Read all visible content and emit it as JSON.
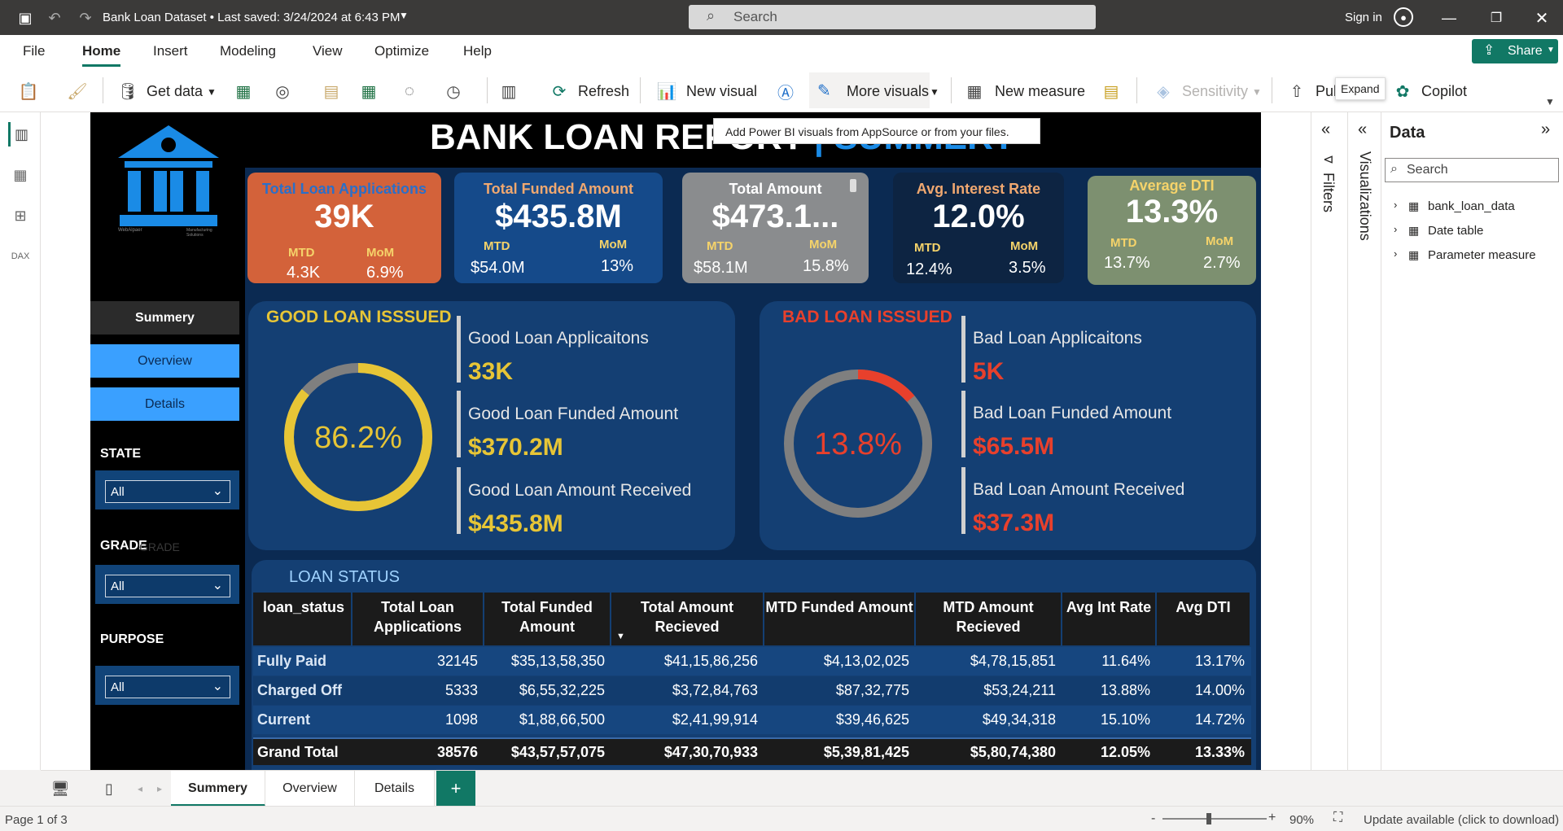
{
  "titlebar": {
    "title": "Bank Loan Dataset • Last saved: 3/24/2024 at 6:43 PM",
    "search": "Search",
    "signin": "Sign in"
  },
  "menu": [
    "File",
    "Home",
    "Insert",
    "Modeling",
    "View",
    "Optimize",
    "Help"
  ],
  "share": "Share",
  "ribbon": {
    "get_data": "Get data",
    "refresh": "Refresh",
    "new_visual": "New visual",
    "more_visuals": "More visuals",
    "new_measure": "New measure",
    "sensitivity": "Sensitivity",
    "publish": "Pul",
    "copilot": "Copilot"
  },
  "tooltip": "Add Power BI visuals from AppSource or from your files.",
  "expand_tip": "Expand",
  "report": {
    "title_a": "BANK LOAN REPORT",
    "title_b": "| SUMMERY",
    "logo_small_left": "WebAlpaer",
    "logo_small_right": "Manufacturing Solutions",
    "nav": [
      "Summery",
      "Overview",
      "Details"
    ],
    "filters": [
      {
        "label": "STATE",
        "value": "All"
      },
      {
        "label": "GRADE",
        "ghost": "GRADE",
        "value": "All"
      },
      {
        "label": "PURPOSE",
        "value": "All"
      }
    ],
    "kpis": [
      {
        "title": "Total Loan Applications",
        "value": "39K",
        "mtd_label": "MTD",
        "mom_label": "MoM",
        "mtd": "4.3K",
        "mom": "6.9%",
        "bg": "#d3623a",
        "title_color": "#2a6fc9"
      },
      {
        "title": "Total Funded Amount",
        "value": "$435.8M",
        "mtd_label": "MTD",
        "mom_label": "MoM",
        "mtd": "$54.0M",
        "mom": "13%",
        "bg": "#154a8a",
        "title_color": "#f0a870"
      },
      {
        "title": "Total Amount",
        "value": "$473.1...",
        "mtd_label": "MTD",
        "mom_label": "MoM",
        "mtd": "$58.1M",
        "mom": "15.8%",
        "bg": "#8a8c8e",
        "title_color": "#ffffff"
      },
      {
        "title": "Avg. Interest Rate",
        "value": "12.0%",
        "mtd_label": "MTD",
        "mom_label": "MoM",
        "mtd": "12.4%",
        "mom": "3.5%",
        "bg": "#0d2442",
        "title_color": "#f0a870"
      },
      {
        "title": "Average DTI",
        "value": "13.3%",
        "mtd_label": "MTD",
        "mom_label": "MoM",
        "mtd": "13.7%",
        "mom": "2.7%",
        "bg": "#7d9070",
        "title_color": "#f5d36a"
      }
    ],
    "good": {
      "title": "GOOD LOAN ISSSUED",
      "pct": "86.2%",
      "pct_value": 0.862,
      "color": "#e7c536",
      "items": [
        {
          "label": "Good Loan Applicaitons",
          "value": "33K"
        },
        {
          "label": "Good Loan Funded Amount",
          "value": "$370.2M"
        },
        {
          "label": "Good Loan Amount Received",
          "value": "$435.8M"
        }
      ]
    },
    "bad": {
      "title": "BAD LOAN ISSSUED",
      "pct": "13.8%",
      "pct_value": 0.138,
      "color": "#e8402c",
      "items": [
        {
          "label": "Bad Loan Applicaitons",
          "value": "5K"
        },
        {
          "label": "Bad Loan Funded Amount",
          "value": "$65.5M"
        },
        {
          "label": "Bad Loan Amount Received",
          "value": "$37.3M"
        }
      ]
    },
    "table": {
      "title": "LOAN STATUS",
      "headers": [
        "loan_status",
        "Total Loan Applications",
        "Total Funded Amount",
        "Total Amount Recieved",
        "MTD Funded Amount",
        "MTD Amount Recieved",
        "Avg Int Rate",
        "Avg DTI"
      ],
      "rows": [
        [
          "Fully Paid",
          "32145",
          "$35,13,58,350",
          "$41,15,86,256",
          "$4,13,02,025",
          "$4,78,15,851",
          "11.64%",
          "13.17%"
        ],
        [
          "Charged Off",
          "5333",
          "$6,55,32,225",
          "$3,72,84,763",
          "$87,32,775",
          "$53,24,211",
          "13.88%",
          "14.00%"
        ],
        [
          "Current",
          "1098",
          "$1,88,66,500",
          "$2,41,99,914",
          "$39,46,625",
          "$49,34,318",
          "15.10%",
          "14.72%"
        ]
      ],
      "total": [
        "Grand Total",
        "38576",
        "$43,57,57,075",
        "$47,30,70,933",
        "$5,39,81,425",
        "$5,80,74,380",
        "12.05%",
        "13.33%"
      ]
    }
  },
  "panes": {
    "filters": "Filters",
    "visualizations": "Visualizations",
    "data": "Data",
    "search": "Search",
    "tree": [
      "bank_loan_data",
      "Date table",
      "Parameter measure"
    ]
  },
  "tabs": [
    "Summery",
    "Overview",
    "Details"
  ],
  "status": {
    "page": "Page 1 of 3",
    "zoom": "90%",
    "update": "Update available (click to download)"
  }
}
